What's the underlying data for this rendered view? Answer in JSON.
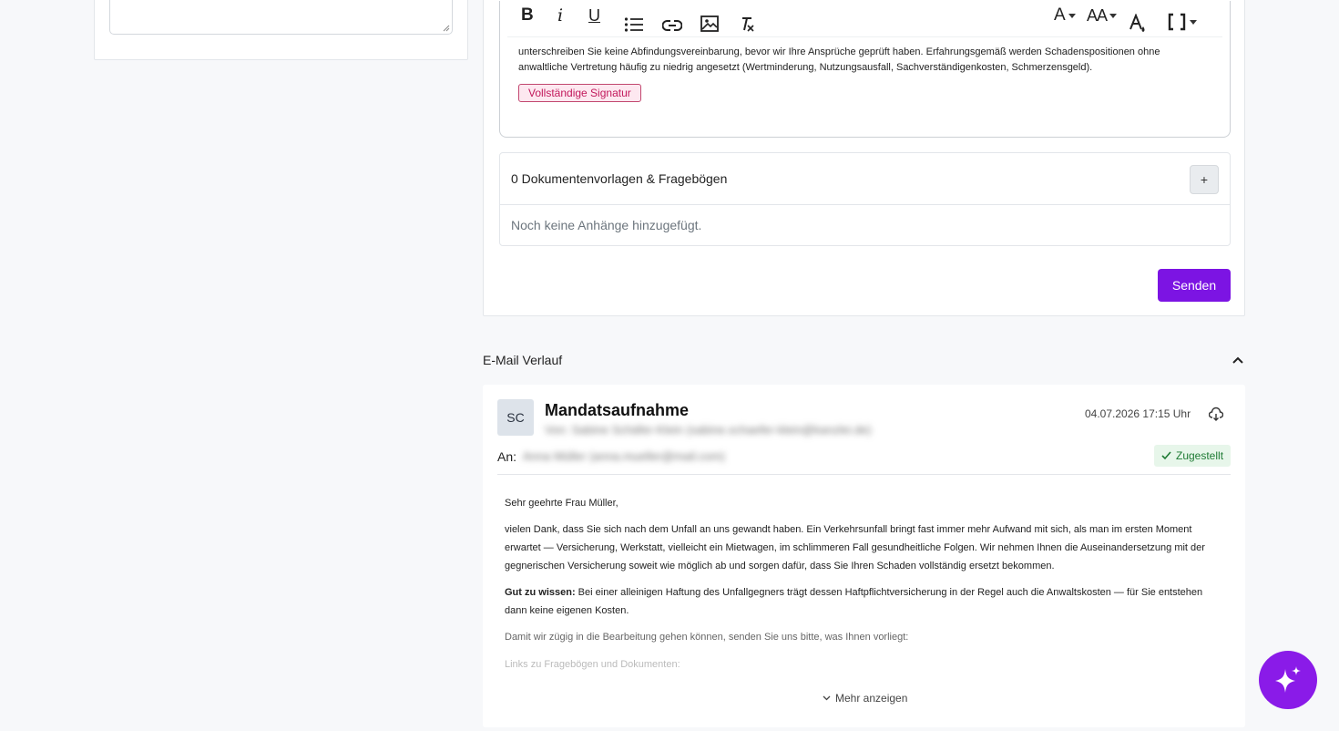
{
  "composer": {
    "toolbar": {
      "bold": "B",
      "italic": "i",
      "underline": "U",
      "font_color": "A",
      "font_size": "AA"
    },
    "body_line1": "unterschreiben Sie keine Abfindungsvereinbarung, bevor wir Ihre Ansprüche geprüft haben. Erfahrungsgemäß werden Schadenspositionen ohne",
    "body_line2": "anwaltliche Vertretung häufig zu niedrig angesetzt (Wertminderung, Nutzungsausfall, Sachverständigenkosten, Schmerzensgeld).",
    "signature_chip": "Vollständige Signatur",
    "attachments_title": "0 Dokumentenvorlagen & Fragebögen",
    "attachments_add": "+",
    "attachments_empty": "Noch keine Anhänge hinzugefügt.",
    "send_label": "Senden"
  },
  "history": {
    "title": "E-Mail Verlauf",
    "mail": {
      "avatar": "SC",
      "subject": "Mandatsaufnahme",
      "from": "Von: Sabine Schäfer-Klein (sabine.schaefer-klein@kanzlei.de)",
      "date": "04.07.2026 17:15 Uhr",
      "to_label": "An:",
      "to_value": "Anna Müller (anna.mueller@mail.com)",
      "status": "Zugestellt",
      "greeting": "Sehr geehrte Frau Müller,",
      "paragraph1": "vielen Dank, dass Sie sich nach dem Unfall an uns gewandt haben. Ein Verkehrsunfall bringt fast immer mehr Aufwand mit sich, als man im ersten Moment erwartet — Versicherung, Werkstatt, vielleicht ein Mietwagen, im schlimmeren Fall gesundheitliche Folgen. Wir nehmen Ihnen die Auseinandersetzung mit der gegnerischen Versicherung soweit wie möglich ab und sorgen dafür, dass Sie Ihren Schaden vollständig ersetzt bekommen.",
      "tip_label": "Gut zu wissen:",
      "tip_text": " Bei einer alleinigen Haftung des Unfallgegners trägt dessen Haftpflichtversicherung in der Regel auch die Anwaltskosten — für Sie entstehen dann keine eigenen Kosten.",
      "paragraph3": "Damit wir zügig in die Bearbeitung gehen können, senden Sie uns bitte, was Ihnen vorliegt:",
      "paragraph4": "Links zu Fragebögen und Dokumenten:",
      "more": "Mehr anzeigen"
    }
  },
  "colors": {
    "primary": "#7c14e3",
    "fab": "#8a1be8",
    "chip_text": "#c2185b",
    "status_green": "#1e7b34"
  }
}
